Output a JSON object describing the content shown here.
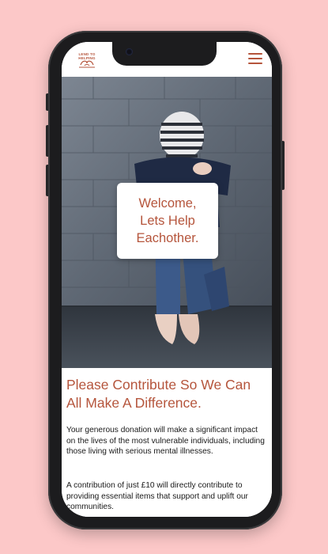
{
  "header": {
    "logo_text": "LEND TO HELPING",
    "menu_icon": "hamburger-menu-icon"
  },
  "hero": {
    "welcome_text": "Welcome,\nLets Help\nEachother."
  },
  "content": {
    "heading": "Please Contribute So We Can All Make A Difference.",
    "paragraph_1": "Your generous donation will make a significant impact on the lives of the most vulnerable individuals, including those living with serious mental illnesses.",
    "paragraph_2": "A contribution of just £10 will directly contribute to providing essential items that support and uplift our communities."
  },
  "colors": {
    "accent": "#b5553c",
    "background": "#fcc8c8",
    "phone_frame": "#1c1c1e"
  }
}
